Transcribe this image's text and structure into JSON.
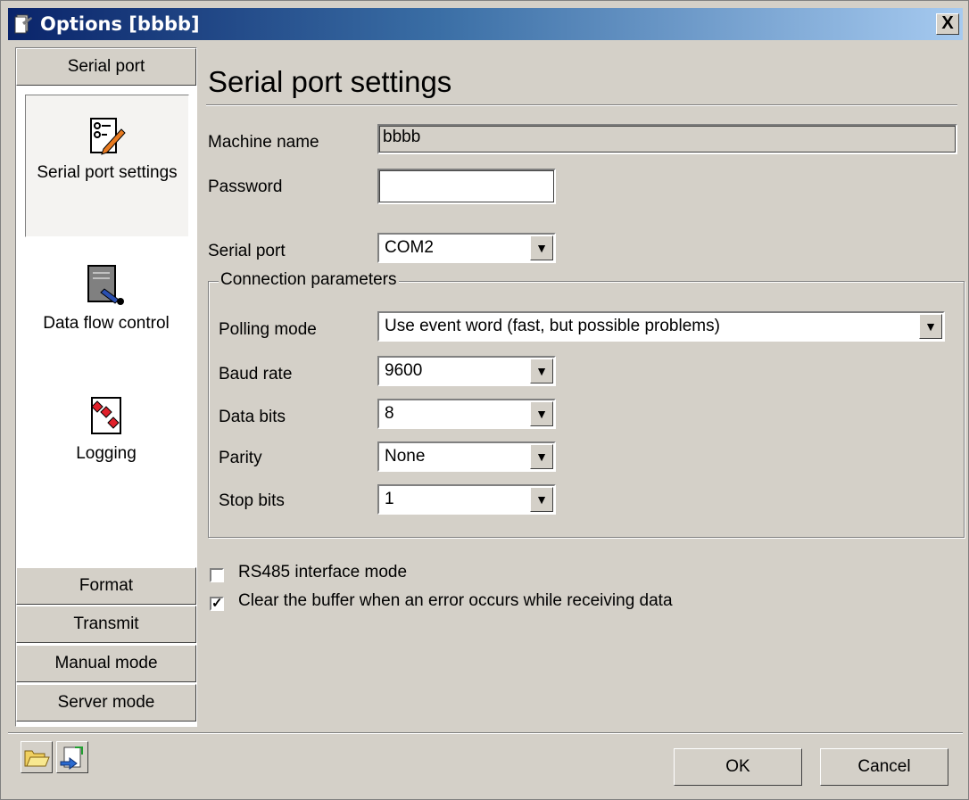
{
  "window": {
    "title": "Options [bbbb]",
    "close_label": "X"
  },
  "nav": {
    "sections": [
      {
        "label": "Serial port"
      },
      {
        "label": "Format"
      },
      {
        "label": "Transmit"
      },
      {
        "label": "Manual mode"
      },
      {
        "label": "Server mode"
      }
    ],
    "items": [
      {
        "label": "Serial port settings",
        "icon": "settings-pen-icon",
        "selected": true
      },
      {
        "label": "Data flow control",
        "icon": "document-plug-icon",
        "selected": false
      },
      {
        "label": "Logging",
        "icon": "log-diamonds-icon",
        "selected": false
      }
    ]
  },
  "page": {
    "heading": "Serial port settings",
    "machine_name": {
      "label": "Machine name",
      "value": "bbbb"
    },
    "password": {
      "label": "Password",
      "value": ""
    },
    "serial_port": {
      "label": "Serial port",
      "value": "COM2"
    },
    "connection": {
      "title": "Connection parameters",
      "polling_mode": {
        "label": "Polling mode",
        "value": "Use event word (fast, but possible problems)"
      },
      "baud_rate": {
        "label": "Baud rate",
        "value": "9600"
      },
      "data_bits": {
        "label": "Data bits",
        "value": "8"
      },
      "parity": {
        "label": "Parity",
        "value": "None"
      },
      "stop_bits": {
        "label": "Stop bits",
        "value": "1"
      }
    },
    "rs485": {
      "label": "RS485 interface mode",
      "checked": false
    },
    "clear_buffer": {
      "label": "Clear the buffer when an error occurs while receiving data",
      "checked": true
    }
  },
  "footer": {
    "open_icon": "folder-open-icon",
    "save_icon": "export-icon",
    "ok_label": "OK",
    "cancel_label": "Cancel"
  },
  "colors": {
    "face": "#d4d0c8",
    "title_start": "#0a246a",
    "title_end": "#a6caf0"
  }
}
